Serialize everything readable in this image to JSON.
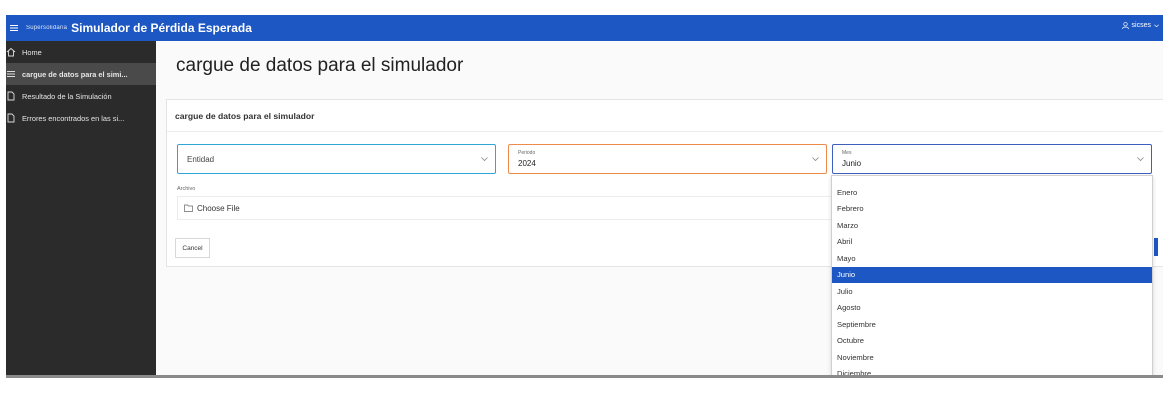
{
  "topbar": {
    "brand": "Supersolidaria",
    "app_title": "Simulador de Pérdida Esperada",
    "user_name": "sicses"
  },
  "sidebar": {
    "items": [
      {
        "label": "Home",
        "icon": "home-icon",
        "active": false
      },
      {
        "label": "cargue de datos para el simi...",
        "icon": "list-icon",
        "active": true
      },
      {
        "label": "Resultado de la Simulación",
        "icon": "document-icon",
        "active": false
      },
      {
        "label": "Errores encontrados en las si...",
        "icon": "document-icon",
        "active": false
      }
    ]
  },
  "main": {
    "page_title": "cargue de datos para el simulador",
    "panel_heading": "cargue de datos para el simulador",
    "entidad": {
      "placeholder": "Entidad"
    },
    "periodo": {
      "label": "Periodo",
      "value": "2024"
    },
    "mes": {
      "label": "Mes",
      "value": "Junio"
    },
    "archivo": {
      "label": "Archivo",
      "button_text": "Choose File"
    },
    "cancel_label": "Cancel"
  },
  "dropdown": {
    "selected": "Junio",
    "options": [
      "Enero",
      "Febrero",
      "Marzo",
      "Abril",
      "Mayo",
      "Junio",
      "Julio",
      "Agosto",
      "Septiembre",
      "Octubre",
      "Noviembre",
      "Diciembre"
    ]
  },
  "colors": {
    "topbar": "#1c57c4",
    "sidebar": "#2b2b2b",
    "entidad_border": "#2ea6d6",
    "periodo_border": "#f08a4b",
    "mes_border": "#3f5fbf",
    "selected_option": "#1c57c4"
  }
}
